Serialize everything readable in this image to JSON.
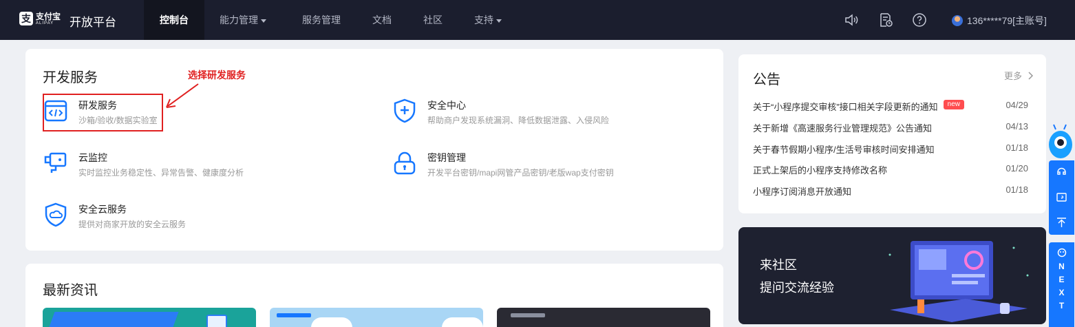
{
  "header": {
    "logo_cn": "支付宝",
    "logo_en": "ALIPAY",
    "platform": "开放平台",
    "nav": [
      {
        "label": "控制台",
        "active": true
      },
      {
        "label": "能力管理",
        "dropdown": true
      },
      {
        "label": "服务管理"
      },
      {
        "label": "文档"
      },
      {
        "label": "社区"
      },
      {
        "label": "支持",
        "dropdown": true
      }
    ],
    "icons": [
      "speaker-icon",
      "document-clock-icon",
      "help-icon"
    ],
    "account": "136*****79[主账号]"
  },
  "dev_services": {
    "title": "开发服务",
    "annotation": "选择研发服务",
    "items": [
      {
        "name": "研发服务",
        "desc": "沙箱/验收/数据实验室",
        "icon": "code-window-icon"
      },
      {
        "name": "安全中心",
        "desc": "帮助商户发现系统漏洞、降低数据泄露、入侵风险",
        "icon": "shield-plus-icon"
      },
      {
        "name": "云监控",
        "desc": "实时监控业务稳定性、异常告警、健康度分析",
        "icon": "camera-monitor-icon"
      },
      {
        "name": "密钥管理",
        "desc": "开发平台密钥/mapi网管产品密钥/老版wap支付密钥",
        "icon": "lock-icon"
      },
      {
        "name": "安全云服务",
        "desc": "提供对商家开放的安全云服务",
        "icon": "shield-cloud-icon"
      }
    ]
  },
  "news": {
    "title": "最新资讯"
  },
  "notices": {
    "title": "公告",
    "more": "更多",
    "items": [
      {
        "text": "关于“小程序提交审核”接口相关字段更新的通知",
        "badge": "new",
        "date": "04/29"
      },
      {
        "text": "关于新增《高速服务行业管理规范》公告通知",
        "date": "04/13"
      },
      {
        "text": "关于春节假期小程序/生活号审核时间安排通知",
        "date": "01/18"
      },
      {
        "text": "正式上架后的小程序支持修改名称",
        "date": "01/20"
      },
      {
        "text": "小程序订阅消息开放通知",
        "date": "01/18"
      }
    ]
  },
  "community": {
    "line1": "来社区",
    "line2": "提问交流经验"
  },
  "float": {
    "next_letters": [
      "N",
      "E",
      "X",
      "T"
    ]
  },
  "colors": {
    "topbar": "#1b1e2e",
    "accent_blue": "#1677ff",
    "annotation_red": "#e02020"
  }
}
